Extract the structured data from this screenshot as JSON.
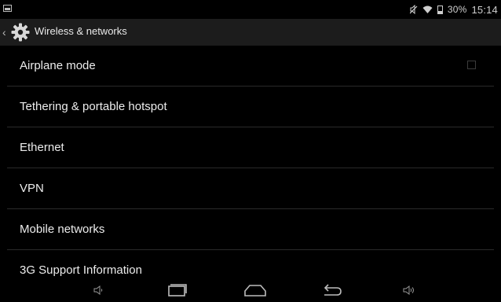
{
  "status_bar": {
    "battery_percent": "30%",
    "time": "15:14",
    "icons": [
      "notification-icon",
      "mute-icon",
      "wifi-icon",
      "battery-icon"
    ]
  },
  "action_bar": {
    "title": "Wireless & networks",
    "icon": "gear-icon"
  },
  "settings": [
    {
      "label": "Airplane mode",
      "has_checkbox": true,
      "checked": false
    },
    {
      "label": "Tethering & portable hotspot"
    },
    {
      "label": "Ethernet"
    },
    {
      "label": "VPN"
    },
    {
      "label": "Mobile networks"
    },
    {
      "label": "3G Support Information"
    }
  ],
  "nav_bar": {
    "buttons": [
      "volume-down-icon",
      "recent-apps-icon",
      "home-icon",
      "back-icon",
      "volume-up-icon"
    ]
  },
  "colors": {
    "background": "#000000",
    "action_bar": "#1c1c1c",
    "text": "#ececec",
    "divider": "#2a2a2a"
  }
}
